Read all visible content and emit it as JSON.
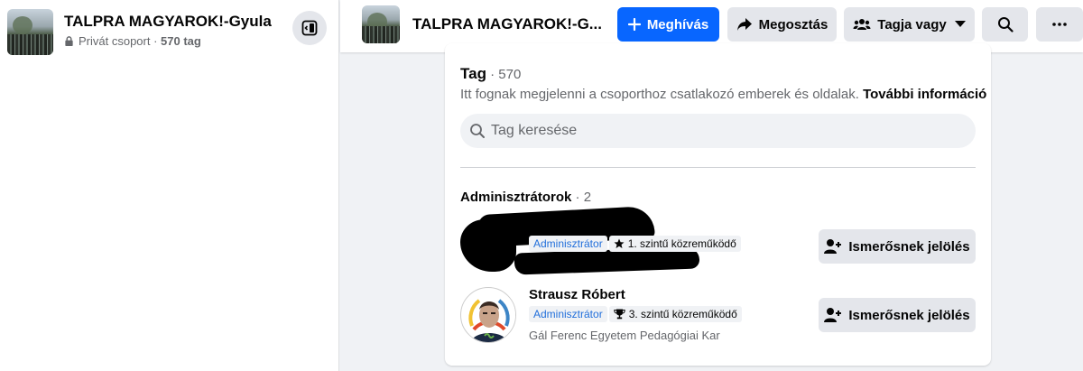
{
  "sidebar": {
    "group_name": "TALPRA MAGYAROK!-Gyula",
    "privacy": "Privát csoport",
    "separator": " · ",
    "member_count": "570 tag"
  },
  "header": {
    "group_name": "TALPRA MAGYAROK!-G...",
    "invite_label": "Meghívás",
    "share_label": "Megosztás",
    "joined_label": "Tagja vagy"
  },
  "members": {
    "title": "Tag",
    "count": " · 570",
    "description": "Itt fognak megjelenni a csoporthoz csatlakozó emberek és oldalak.",
    "more_info": "További információ",
    "search_placeholder": "Tag keresése",
    "admins_title": "Adminisztrátorok",
    "admins_count": " · 2",
    "list": [
      {
        "name": "",
        "role": "Adminisztrátor",
        "contributor": "1. szintű közreműködő",
        "contributor_icon": "star-icon",
        "extra": "",
        "button": "Ismerősnek jelölés",
        "redacted": true
      },
      {
        "name": "Strausz Róbert",
        "role": "Adminisztrátor",
        "contributor": "3. szintű közreműködő",
        "contributor_icon": "trophy-icon",
        "extra": "Gál Ferenc Egyetem Pedagógiai Kar",
        "button": "Ismerősnek jelölés",
        "redacted": false
      }
    ]
  },
  "colors": {
    "primary": "#0866ff",
    "admin_text": "#216fdb",
    "secondary_text": "#65676b",
    "page_bg": "#f0f2f5"
  }
}
